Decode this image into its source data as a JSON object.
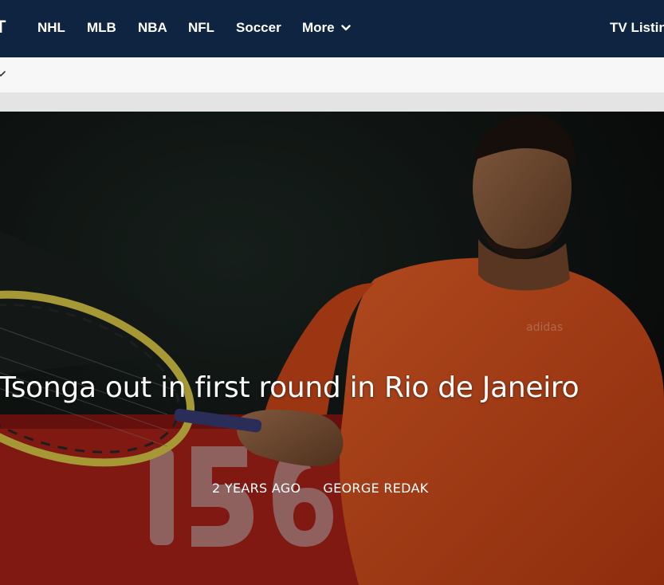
{
  "nav": {
    "logo_fragment": "T",
    "items": [
      {
        "label": "NHL"
      },
      {
        "label": "MLB"
      },
      {
        "label": "NBA"
      },
      {
        "label": "NFL"
      },
      {
        "label": "Soccer"
      }
    ],
    "more_label": "More",
    "more_icon": "chevron-down-icon",
    "tv_label": "TV Listin"
  },
  "subbar": {
    "icon": "chevron-down-icon"
  },
  "article": {
    "headline": "Tsonga out in first round in Rio de Janeiro",
    "time_ago": "2 YEARS AGO",
    "author": "GEORGE REDAK",
    "hero_image": {
      "description_icon": "tennis-player-photo",
      "scoreboard_digits": "156"
    }
  },
  "colors": {
    "nav_background": "#0f2440",
    "subbar_background": "#f7f7f7",
    "strip_background": "#e4e4e4",
    "shirt_orange": "#e8541c",
    "board_red": "#b3231b"
  }
}
